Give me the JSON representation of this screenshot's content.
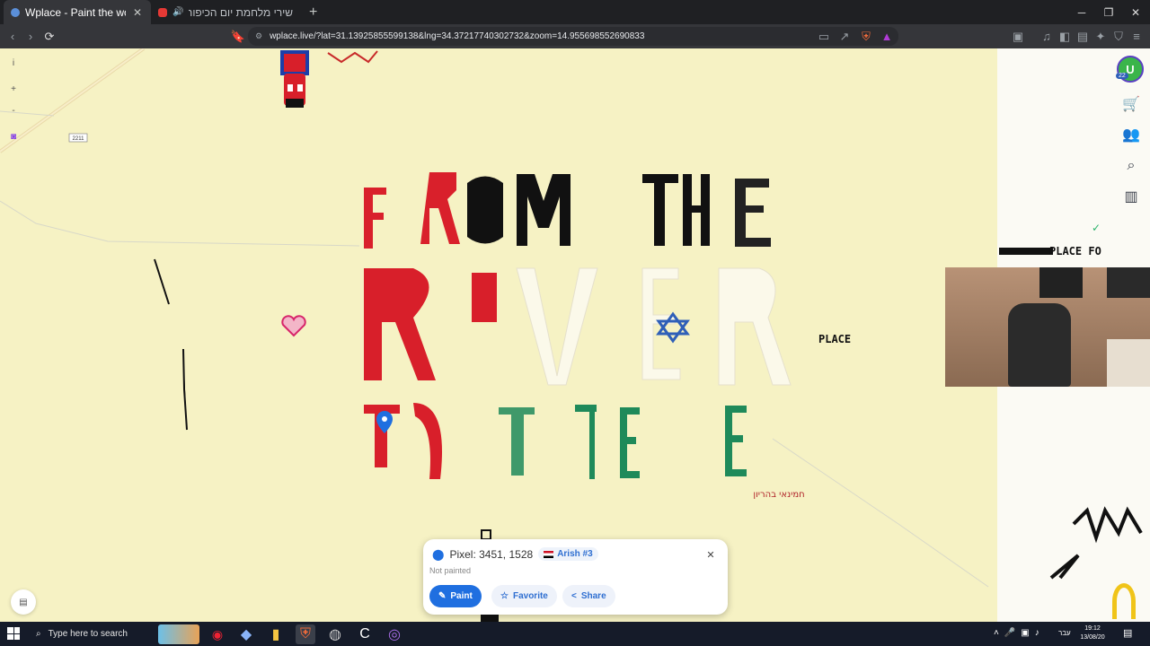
{
  "browser": {
    "tabs": [
      {
        "title": "Wplace - Paint the world",
        "active": true,
        "favicon": "globe-icon"
      },
      {
        "title": "שירי מלחמת יום הכיפורים - יום ה׳",
        "active": false,
        "favicon": "youtube-icon",
        "audio": "speaker-icon"
      }
    ],
    "url": "wplace.live/?lat=31.13925855599138&lng=34.37217740302732&zoom=14.955698552690833"
  },
  "map": {
    "road_label": "2211",
    "canvas_text": [
      "PLACE FO",
      "PLACE"
    ],
    "hebrew_tag": "חמינאי בהריון",
    "left_controls": [
      "i",
      "+",
      "-"
    ],
    "right_controls": [
      "cart-icon",
      "users-icon",
      "search-location-icon",
      "leaderboard-icon"
    ],
    "avatar_badge": "22"
  },
  "pixel_panel": {
    "label": "Pixel: 3451, 1528",
    "region": "Arish #3",
    "status": "Not painted",
    "buttons": {
      "paint": "Paint",
      "favorite": "Favorite",
      "share": "Share"
    }
  },
  "taskbar": {
    "search_placeholder": "Type here to search",
    "language": "עבר",
    "time": "19:12",
    "date": "13/08/20"
  },
  "colors": {
    "map_bg": "#f6f2c4",
    "accent": "#1f6fe0",
    "red_pixels": "#d91f26",
    "green_pixels": "#1f8a5a"
  }
}
